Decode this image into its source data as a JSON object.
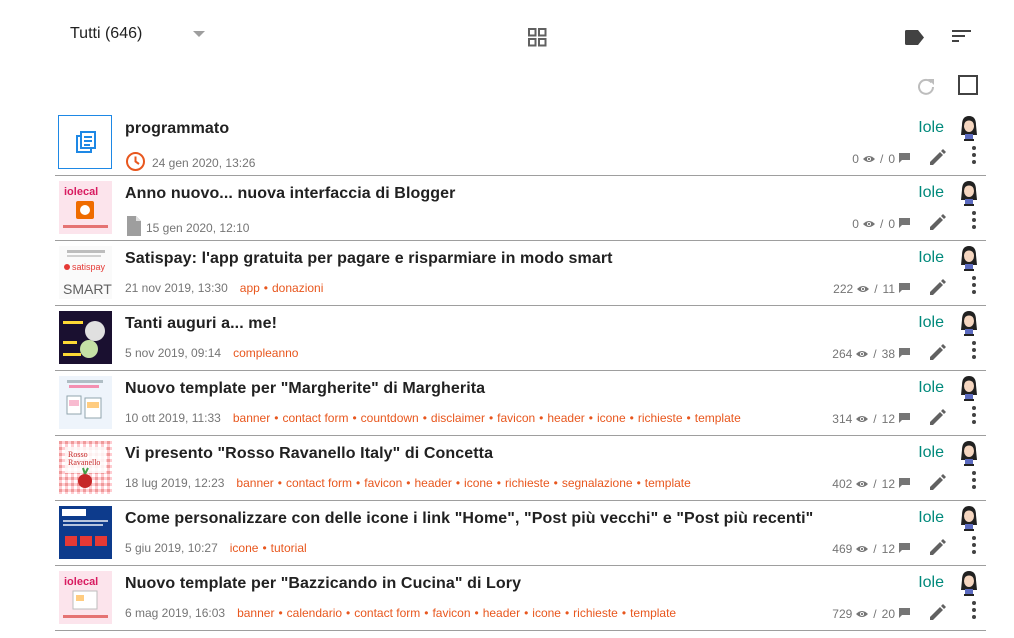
{
  "toolbar": {
    "filter_label": "Tutti (646)",
    "view_icon": "grid-view-icon",
    "label_icon": "label-icon",
    "sort_icon": "sort-icon",
    "refresh_icon": "refresh-icon",
    "select_all_icon": "checkbox-icon"
  },
  "colors": {
    "accent": "#00897b",
    "label": "#e8571e",
    "scheduled": "#e8571e",
    "divider": "#9e9e9e"
  },
  "posts": [
    {
      "title": "programmato",
      "status_icon": "clock-icon",
      "date": "24 gen 2020, 13:26",
      "labels": [],
      "views": "0",
      "comments": "0",
      "author": "Iole"
    },
    {
      "title": "Anno nuovo... nuova interfaccia di Blogger",
      "status_icon": "draft-icon",
      "date": "15 gen 2020, 12:10",
      "labels": [],
      "views": "0",
      "comments": "0",
      "author": "Iole"
    },
    {
      "title": "Satispay: l'app gratuita per pagare e risparmiare in modo smart",
      "date": "21 nov 2019, 13:30",
      "labels": [
        "app",
        "donazioni"
      ],
      "views": "222",
      "comments": "11",
      "author": "Iole"
    },
    {
      "title": "Tanti auguri a... me!",
      "date": "5 nov 2019, 09:14",
      "labels": [
        "compleanno"
      ],
      "views": "264",
      "comments": "38",
      "author": "Iole"
    },
    {
      "title": "Nuovo template per \"Margherite\" di Margherita",
      "date": "10 ott 2019, 11:33",
      "labels": [
        "banner",
        "contact form",
        "countdown",
        "disclaimer",
        "favicon",
        "header",
        "icone",
        "richieste",
        "template"
      ],
      "views": "314",
      "comments": "12",
      "author": "Iole"
    },
    {
      "title": "Vi presento \"Rosso Ravanello Italy\" di Concetta",
      "date": "18 lug 2019, 12:23",
      "labels": [
        "banner",
        "contact form",
        "favicon",
        "header",
        "icone",
        "richieste",
        "segnalazione",
        "template"
      ],
      "views": "402",
      "comments": "12",
      "author": "Iole"
    },
    {
      "title": "Come personalizzare con delle icone i link \"Home\", \"Post più vecchi\" e \"Post più recenti\"",
      "date": "5 giu 2019, 10:27",
      "labels": [
        "icone",
        "tutorial"
      ],
      "views": "469",
      "comments": "12",
      "author": "Iole"
    },
    {
      "title": "Nuovo template per \"Bazzicando in Cucina\" di Lory",
      "date": "6 mag 2019, 16:03",
      "labels": [
        "banner",
        "calendario",
        "contact form",
        "favicon",
        "header",
        "icone",
        "richieste",
        "template"
      ],
      "views": "729",
      "comments": "20",
      "author": "Iole"
    }
  ]
}
